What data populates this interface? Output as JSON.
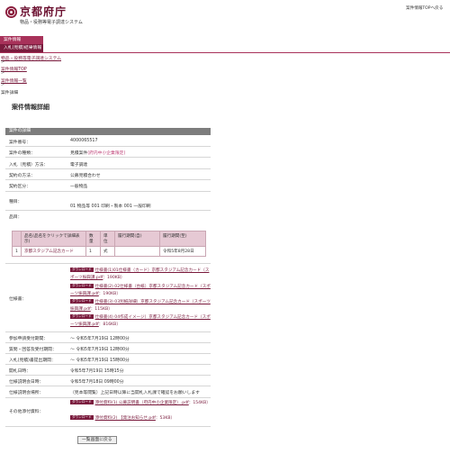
{
  "header": {
    "logo_text": "京都府庁",
    "system_name": "物品・役務等電子調達システム",
    "top_link": "案件情報TOPへ戻る"
  },
  "nav": {
    "tabs": [
      "案件情報",
      "入札(見積)結果情報"
    ]
  },
  "breadcrumb": {
    "items": [
      "物品・役務等電子調達システム",
      "案件情報TOP",
      "案件情報一覧",
      "案件詳細"
    ],
    "separator": ">"
  },
  "page_title": "案件情報詳細",
  "section_title": "案件の詳細",
  "details": {
    "case_number": {
      "label": "案件番号：",
      "value": "4000065517"
    },
    "case_type": {
      "label": "案件の種類：",
      "value": "見積案件",
      "note": "(府内中小企業限定)"
    },
    "bid_method": {
      "label": "入札（見積）方法：",
      "value": "電子調達"
    },
    "contract_method": {
      "label": "契約の方法：",
      "value": "公募見積合わせ"
    },
    "contract_category": {
      "label": "契約区分：",
      "value": "一般物品"
    },
    "type": {
      "label": "種目：",
      "value": "01  物品等  001  印刷・製本  001  一般印刷"
    },
    "items_label": "品目："
  },
  "items_table": {
    "headers": [
      "",
      "品名(品名をクリックで詳細表示)",
      "数量",
      "単位",
      "履行期間(自)",
      "履行期間(至)"
    ],
    "rows": [
      [
        "1",
        "京都スタジアム記念カード",
        "1",
        "式",
        "",
        "令和5年8月28日"
      ]
    ]
  },
  "specs": {
    "label": "仕様書：",
    "badge": "ダウンロード",
    "files": [
      {
        "text": "仕様書(1)01仕様書（カード）京都スタジアム記念カード（スポーツ振興課.pdf",
        "size": "：190KB）"
      },
      {
        "text": "仕様書(2) 02仕様書（台紙）京都スタジアム記念カード（スポーツ振興課.pdf",
        "size": "：190KB）"
      },
      {
        "text": "仕様書(3) 03別紙詳細）京都スタジアム記念カード（スポーツ振興課.pdf",
        "size": "：115KB）"
      },
      {
        "text": "仕様書(4) 04作成イメージ）京都スタジアム記念カード（スポーツ振興課.pdf",
        "size": "：816KB）"
      }
    ]
  },
  "schedule": {
    "participation_period": {
      "label": "参加申請受付期間：",
      "value": "～ 令和5年7月19日 12時00分"
    },
    "question_period": {
      "label": "質問・回答及受付期間：",
      "value": "～ 令和5年7月19日 12時00分"
    },
    "bid_period": {
      "label": "入札(見積)書提出期間：",
      "value": "～ 令和5年7月19日 15時00分"
    },
    "opening_date": {
      "label": "開札日時：",
      "value": "令和5年7月19日 15時15分"
    },
    "briefing_date": {
      "label": "仕様説明会日時：",
      "value": "令和5年7月18日 09時00分"
    },
    "briefing_place": {
      "label": "仕様説明会場所：",
      "value": "（見本等閲覧）上記日時以降に当開札入札課で確認をお願いします"
    }
  },
  "other": {
    "label": "その他添付資料：",
    "badge": "ダウンロード",
    "files": [
      {
        "text": "添付資料(1) 公募説明書（府内中小企業限定）.pdf",
        "size": "：154KB）"
      },
      {
        "text": "添付資料(2) 【発注お知らせ.pdf",
        "size": "：53KB）"
      }
    ]
  },
  "back_button": "一覧画面に戻る",
  "colors": {
    "brand": "#7a1b3d",
    "brand_light": "#a8325a",
    "section_bar": "#7d7d7d",
    "table_header": "#e6c9d4",
    "case_note": "#c0447a"
  }
}
